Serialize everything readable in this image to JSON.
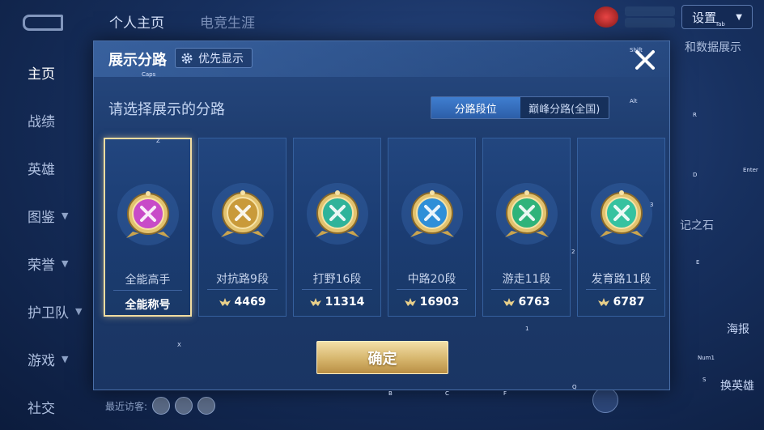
{
  "background": {
    "tabs": [
      "个人主页",
      "电竞生涯"
    ],
    "sidebar": [
      {
        "label": "主页",
        "chevron": false
      },
      {
        "label": "战绩",
        "chevron": false
      },
      {
        "label": "英雄",
        "chevron": false
      },
      {
        "label": "图鉴",
        "chevron": true
      },
      {
        "label": "荣誉",
        "chevron": true
      },
      {
        "label": "护卫队",
        "chevron": true
      },
      {
        "label": "游戏",
        "chevron": true
      },
      {
        "label": "社交",
        "chevron": false
      }
    ],
    "settings_label": "设置",
    "right_link": "和数据展示",
    "stone_label": "记之石",
    "poster_label": "海报",
    "swap_hero_label": "换英雄",
    "visitors_label": "最近访客:"
  },
  "key_hints": {
    "caps": "Caps",
    "shift": "Shift",
    "tab": "Tab",
    "alt": "Alt",
    "r": "R",
    "d": "D",
    "enter": "Enter",
    "three": "3",
    "e": "E",
    "two": "2",
    "one": "1",
    "z": "Z",
    "x": "X",
    "num1": "Num1",
    "s": "S",
    "b": "B",
    "c": "C",
    "f": "F",
    "q": "Q"
  },
  "dialog": {
    "title": "展示分路",
    "priority_button": "优先显示",
    "subtitle": "请选择展示的分路",
    "toggle": {
      "options": [
        "分路段位",
        "巅峰分路(全国)"
      ],
      "selected": 0
    },
    "confirm_button": "确定",
    "cards": [
      {
        "name": "全能高手",
        "badge": "全能称号",
        "score": null,
        "selected": true,
        "emblem": "all-round-emblem-icon",
        "color": "#c84bc8"
      },
      {
        "name": "对抗路9段",
        "badge": null,
        "score": "4469",
        "selected": false,
        "emblem": "clash-lane-emblem-icon",
        "color": "#c99a3a"
      },
      {
        "name": "打野16段",
        "badge": null,
        "score": "11314",
        "selected": false,
        "emblem": "jungle-emblem-icon",
        "color": "#2fb39a"
      },
      {
        "name": "中路20段",
        "badge": null,
        "score": "16903",
        "selected": false,
        "emblem": "mid-lane-emblem-icon",
        "color": "#2f8fd8"
      },
      {
        "name": "游走11段",
        "badge": null,
        "score": "6763",
        "selected": false,
        "emblem": "roam-emblem-icon",
        "color": "#2fb37a"
      },
      {
        "name": "发育路11段",
        "badge": null,
        "score": "6787",
        "selected": false,
        "emblem": "farm-lane-emblem-icon",
        "color": "#36c2a0"
      }
    ]
  }
}
